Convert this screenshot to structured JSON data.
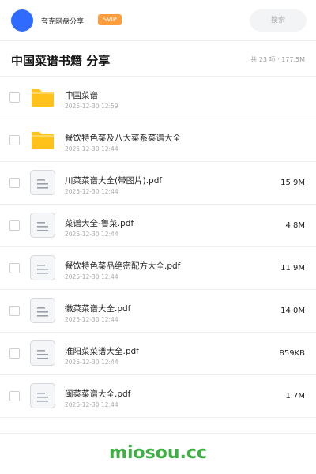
{
  "header": {
    "app_name": "夸克网盘分享",
    "badge": "SVIP",
    "search_placeholder": "搜索"
  },
  "share": {
    "title": "中国菜谱书籍 分享",
    "summary": "共 23 项 · 177.5M"
  },
  "files": [
    {
      "name": "中国菜谱",
      "date": "2025-12-30 12:59",
      "size": "",
      "type": "folder"
    },
    {
      "name": "餐饮特色菜及八大菜系菜谱大全",
      "date": "2025-12-30 12:44",
      "size": "",
      "type": "folder"
    },
    {
      "name": "川菜菜谱大全(带图片).pdf",
      "date": "2025-12-30 12:44",
      "size": "15.9M",
      "type": "file"
    },
    {
      "name": "菜谱大全-鲁菜.pdf",
      "date": "2025-12-30 12:44",
      "size": "4.8M",
      "type": "file"
    },
    {
      "name": "餐饮特色菜品绝密配方大全.pdf",
      "date": "2025-12-30 12:44",
      "size": "11.9M",
      "type": "file"
    },
    {
      "name": "徽菜菜谱大全.pdf",
      "date": "2025-12-30 12:44",
      "size": "14.0M",
      "type": "file"
    },
    {
      "name": "淮阳菜菜谱大全.pdf",
      "date": "2025-12-30 12:44",
      "size": "859KB",
      "type": "file"
    },
    {
      "name": "闽菜菜谱大全.pdf",
      "date": "2025-12-30 12:44",
      "size": "1.7M",
      "type": "file"
    }
  ],
  "watermark": "miosou.cc",
  "colors": {
    "avatar": "#2f6bff",
    "badge": "#ff9d3d",
    "folder": "#ffc21a",
    "watermark": "#3cb043"
  },
  "icons": {
    "folder": "folder-icon",
    "file": "document-icon"
  }
}
